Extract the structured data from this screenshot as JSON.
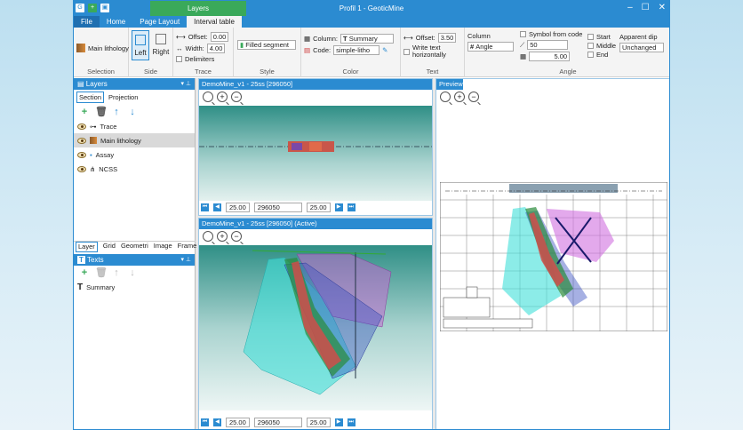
{
  "window": {
    "title": "Profil 1 - GeoticMine",
    "context_tab": "Layers"
  },
  "tabs": [
    "File",
    "Home",
    "Page Layout",
    "Interval table"
  ],
  "ribbon": {
    "selection": {
      "label": "Selection",
      "main_lithology": "Main lithology"
    },
    "side": {
      "label": "Side",
      "left": "Left",
      "right": "Right"
    },
    "trace": {
      "label": "Trace",
      "offset_label": "Offset:",
      "offset_value": "0.00",
      "width_label": "Width:",
      "width_value": "4.00",
      "delimiters": "Delimiters"
    },
    "style": {
      "label": "Style",
      "value": "Filled segment"
    },
    "color": {
      "label": "Color",
      "column_label": "Column:",
      "column_value": "Summary",
      "code_label": "Code:",
      "code_value": "simple-litho"
    },
    "text": {
      "label": "Text",
      "offset_label": "Offset:",
      "offset_value": "3.50",
      "write_horizontal": "Write text horizontally"
    },
    "angle": {
      "label": "Angle",
      "column_label": "Column",
      "column_value": "Angle",
      "symbol_from_code": "Symbol from code",
      "symbol_value": "50",
      "step_value": "5.00",
      "start": "Start",
      "middle": "Middle",
      "end": "End",
      "apparent_dip_label": "Apparent dip",
      "apparent_dip_value": "Unchanged"
    }
  },
  "layers_panel": {
    "title": "Layers",
    "tab_section": "Section",
    "tab_projection": "Projection",
    "items": [
      {
        "label": "Trace",
        "icon": "trace-icon"
      },
      {
        "label": "Main lithology",
        "icon": "lithology-icon",
        "selected": true
      },
      {
        "label": "Assay",
        "icon": "assay-icon"
      },
      {
        "label": "NCSS",
        "icon": "ncss-icon"
      }
    ]
  },
  "bottom_tabs": [
    "Layer",
    "Grid",
    "Geometri",
    "Image",
    "Frame"
  ],
  "texts_panel": {
    "title": "Texts",
    "items": [
      {
        "label": "Summary"
      }
    ]
  },
  "views": {
    "top": {
      "title": "DemoMine_v1 - 25ss [296050]",
      "left_value": "25.00",
      "section_value": "296050",
      "right_value": "25.00"
    },
    "bottom": {
      "title": "DemoMine_v1 - 25ss [296050] (Active)",
      "left_value": "25.00",
      "section_value": "296050",
      "right_value": "25.00"
    },
    "preview": {
      "title": "Preview"
    }
  }
}
